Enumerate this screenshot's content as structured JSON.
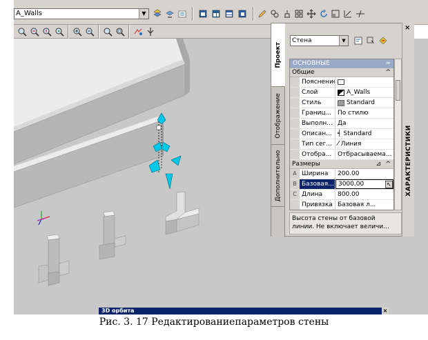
{
  "toolbar": {
    "layer_value": "A_Walls"
  },
  "palette": {
    "title": "ХАРАКТЕРИСТИКИ",
    "tabs": [
      "Проект",
      "Отображение",
      "Дополнительно"
    ],
    "style_combo": "Стена",
    "sections": {
      "basic": "ОСНОВНЫЕ",
      "general": "Общие",
      "dimensions": "Размеры"
    },
    "general_rows": [
      {
        "name": "Пояснение",
        "value": ""
      },
      {
        "name": "Слой",
        "value": "A_Walls"
      },
      {
        "name": "Стиль",
        "value": "Standard"
      },
      {
        "name": "Границ...",
        "value": "По стилю"
      },
      {
        "name": "Выполн...",
        "value": "Да"
      },
      {
        "name": "Описан...",
        "value": "Standard"
      },
      {
        "name": "Тип сег...",
        "value": "Линия"
      },
      {
        "name": "Отобра...",
        "value": "Отбрасываема..."
      }
    ],
    "dimension_rows": [
      {
        "key": "A",
        "name": "Ширина",
        "value": "200.00"
      },
      {
        "key": "B",
        "name": "Базовая...",
        "value": "3000.00"
      },
      {
        "key": "C",
        "name": "Длина",
        "value": "800.00"
      },
      {
        "key": "",
        "name": "Привязка",
        "value": "Базовая л..."
      }
    ],
    "description": "Высота стены от базовой линии.  Не включает величи..."
  },
  "orbit_bar": "3D орбита",
  "caption": "Рис. 3. 17 Редактированиепараметров стены",
  "colors": {
    "toolbar_bg": "#d6d3ce",
    "viewport_bg": "#c8c8c8",
    "wall_top": "#ececec",
    "wall_front": "#b4b4b4",
    "grip": "#00c8e6",
    "section_header": "#9aa9c6",
    "selection": "#0a246a"
  }
}
